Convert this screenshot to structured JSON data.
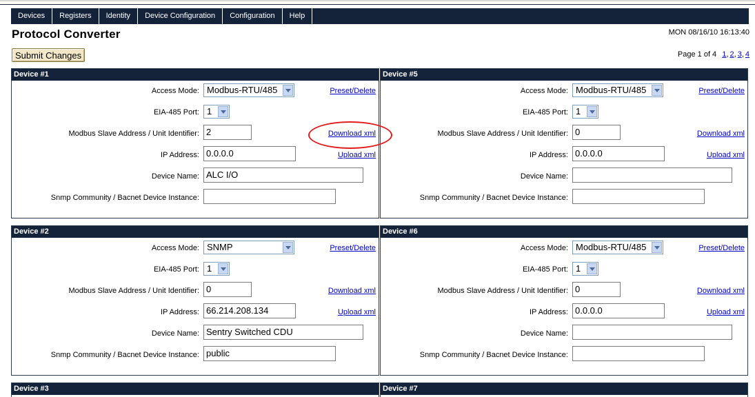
{
  "nav": {
    "items": [
      "Devices",
      "Registers",
      "Identity",
      "Device Configuration",
      "Configuration",
      "Help"
    ]
  },
  "page": {
    "title": "Protocol Converter",
    "datetime": "MON 08/16/10 16:13:40",
    "submit_label": "Submit Changes",
    "pagination": {
      "label": "Page 1 of 4",
      "pages": [
        "1",
        "2",
        "3",
        "4"
      ]
    }
  },
  "labels": {
    "access_mode": "Access Mode:",
    "eia_port": "EIA-485 Port:",
    "slave_address": "Modbus Slave Address / Unit Identifier:",
    "ip_address": "IP Address:",
    "device_name": "Device Name:",
    "snmp_community": "Snmp Community / Bacnet Device Instance:",
    "preset_delete": "Preset/Delete",
    "download_xml": "Download xml",
    "upload_xml": "Upload xml"
  },
  "devices": {
    "d1": {
      "title": "Device #1",
      "access_mode": "Modbus-RTU/485",
      "eia_port": "1",
      "slave_address": "2",
      "ip_address": "0.0.0.0",
      "device_name": "ALC I/O",
      "snmp_community": ""
    },
    "d5": {
      "title": "Device #5",
      "access_mode": "Modbus-RTU/485",
      "eia_port": "1",
      "slave_address": "0",
      "ip_address": "0.0.0.0",
      "device_name": "",
      "snmp_community": ""
    },
    "d2": {
      "title": "Device #2",
      "access_mode": "SNMP",
      "eia_port": "1",
      "slave_address": "0",
      "ip_address": "66.214.208.134",
      "device_name": "Sentry Switched CDU",
      "snmp_community": "public"
    },
    "d6": {
      "title": "Device #6",
      "access_mode": "Modbus-RTU/485",
      "eia_port": "1",
      "slave_address": "0",
      "ip_address": "0.0.0.0",
      "device_name": "",
      "snmp_community": ""
    },
    "d3": {
      "title": "Device #3"
    },
    "d7": {
      "title": "Device #7"
    }
  },
  "colors": {
    "header_bg": "#14233a",
    "link": "#0000cc",
    "highlight_oval": "#e41b1b",
    "button_bg": "#f2e7c6"
  }
}
